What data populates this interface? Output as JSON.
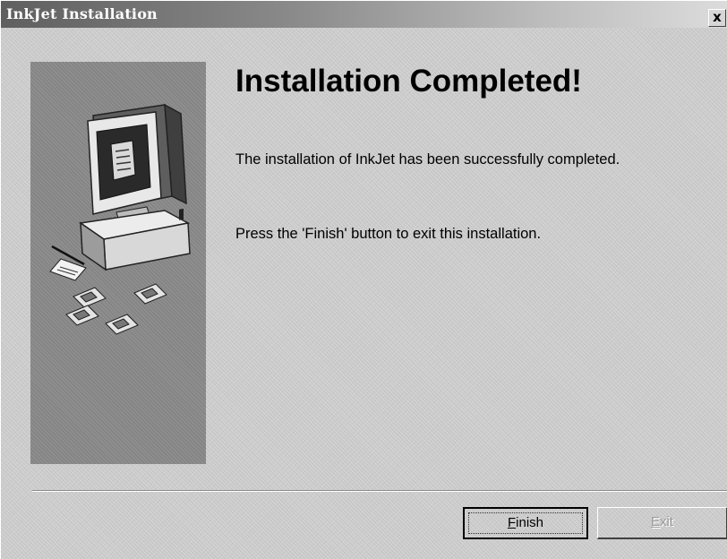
{
  "window": {
    "title": "InkJet Installation",
    "close_label": "x"
  },
  "main": {
    "heading": "Installation Completed!",
    "message": "The installation of InkJet has been successfully completed.",
    "instruction": "Press the 'Finish' button to exit this installation."
  },
  "buttons": {
    "finish": {
      "first": "F",
      "rest": "inish",
      "enabled": true,
      "focused": true
    },
    "exit": {
      "first": "E",
      "rest": "xit",
      "enabled": false
    }
  },
  "icons": {
    "close": "close-icon",
    "illustration": "computer-install-illustration"
  }
}
